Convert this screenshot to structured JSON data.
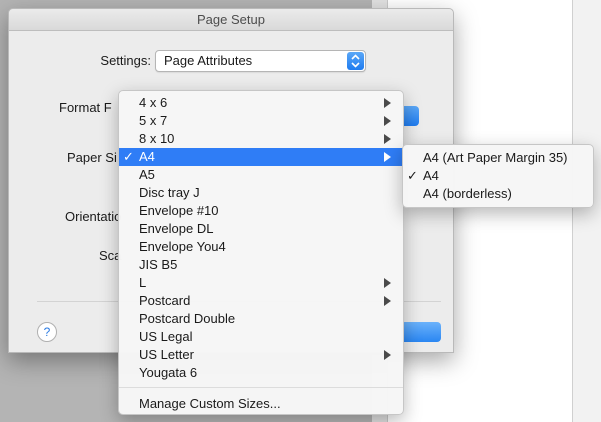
{
  "window": {
    "title": "Page Setup"
  },
  "settings": {
    "label": "Settings:",
    "value": "Page Attributes"
  },
  "labels": {
    "format_for": "Format F",
    "paper_size": "Paper Si",
    "orientation": "Orientatio",
    "scale": "Sca"
  },
  "help_label": "?",
  "menu": {
    "items": [
      {
        "label": "4 x 6",
        "submenu": true
      },
      {
        "label": "5 x 7",
        "submenu": true
      },
      {
        "label": "8 x 10",
        "submenu": true
      },
      {
        "label": "A4",
        "submenu": true,
        "checked": true,
        "selected": true
      },
      {
        "label": "A5"
      },
      {
        "label": "Disc tray J"
      },
      {
        "label": "Envelope #10"
      },
      {
        "label": "Envelope DL"
      },
      {
        "label": "Envelope You4"
      },
      {
        "label": "JIS B5"
      },
      {
        "label": "L",
        "submenu": true
      },
      {
        "label": "Postcard",
        "submenu": true
      },
      {
        "label": "Postcard Double"
      },
      {
        "label": "US Legal"
      },
      {
        "label": "US Letter",
        "submenu": true
      },
      {
        "label": "Yougata 6"
      }
    ],
    "manage_label": "Manage Custom Sizes...",
    "checkmark": "✓"
  },
  "submenu": {
    "items": [
      {
        "label": "A4 (Art Paper Margin 35)"
      },
      {
        "label": "A4",
        "checked": true
      },
      {
        "label": "A4 (borderless)"
      }
    ]
  },
  "colors": {
    "selection": "#2f7df6",
    "accent": "#1f7cf0"
  }
}
